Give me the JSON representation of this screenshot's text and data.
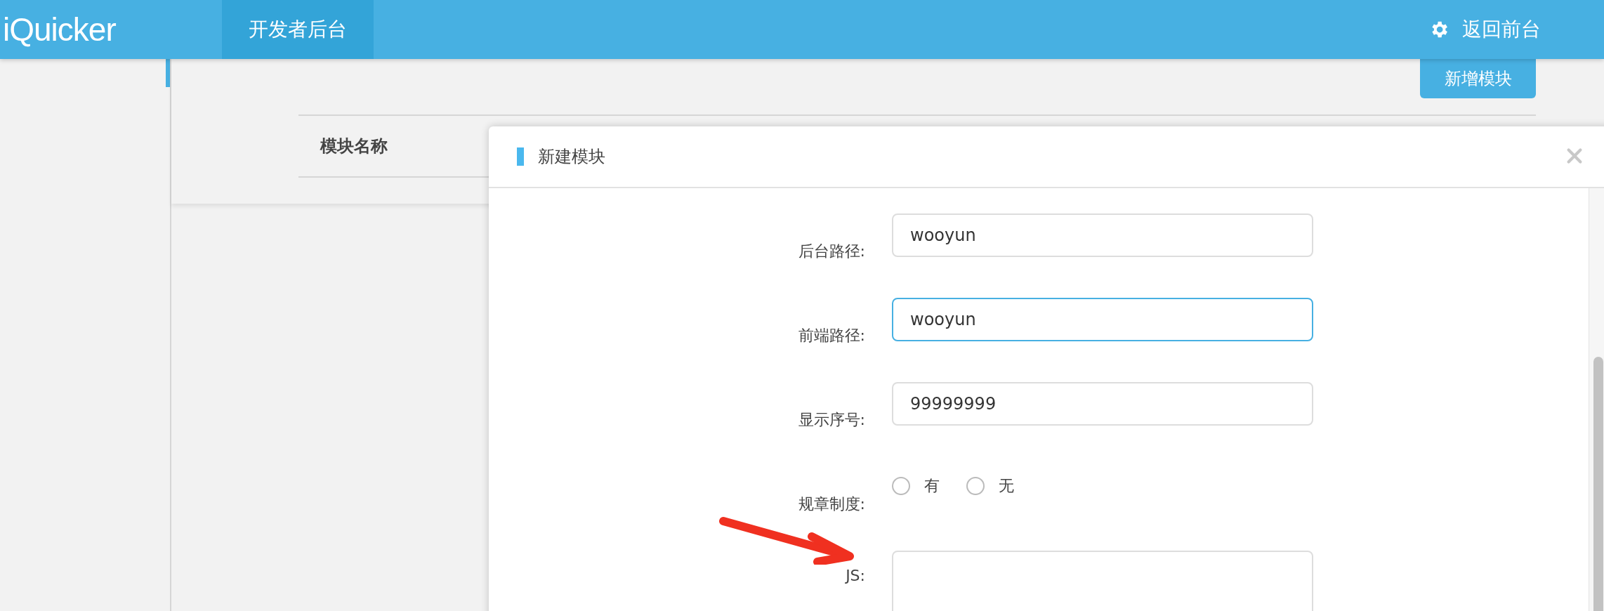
{
  "header": {
    "logo": "iQuicker",
    "nav": [
      {
        "label": "开发者后台",
        "selected": true
      }
    ],
    "back_link": "返回前台"
  },
  "main": {
    "add_button": "新增模块",
    "table": {
      "columns": [
        "模块名称"
      ]
    }
  },
  "dialog": {
    "title": "新建模块",
    "fields": [
      {
        "kind": "text",
        "label": "后台路径:",
        "value": "wooyun",
        "focused": false
      },
      {
        "kind": "text",
        "label": "前端路径:",
        "value": "wooyun",
        "focused": true
      },
      {
        "kind": "text",
        "label": "显示序号:",
        "value": "99999999",
        "focused": false
      },
      {
        "kind": "radio",
        "label": "规章制度:",
        "options": [
          {
            "label": "有",
            "selected": false
          },
          {
            "label": "无",
            "selected": false
          }
        ]
      },
      {
        "kind": "textarea",
        "label": "JS:",
        "focused": false
      }
    ]
  }
}
